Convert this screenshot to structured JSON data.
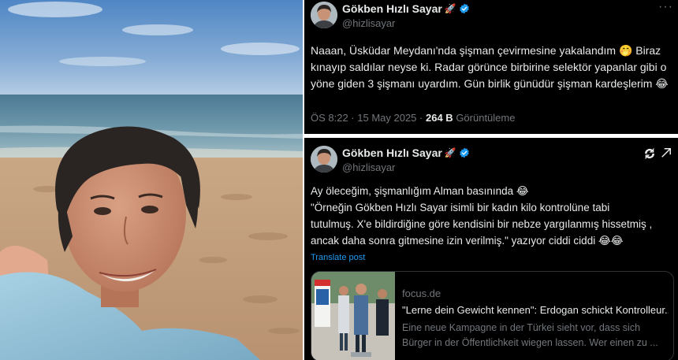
{
  "tweet1": {
    "display_name": "Gökben Hızlı Sayar",
    "handle": "@hizlisayar",
    "more_label": "···",
    "text": "Naaan, Üsküdar Meydanı'nda şişman çevirmesine yakalandım 🤭 Biraz\nkınayıp saldılar neyse ki. Radar görünce birbirine selektör yapanlar gibi o\nyöne giden 3 şişmanı uyardım. Gün birlik günüdür şişman kardeşlerim 😂",
    "time": "ÖS 8:22 · 15 May 2025 ·",
    "views_count": "264 B",
    "views_label": "Görüntüleme"
  },
  "tweet2": {
    "display_name": "Gökben Hızlı Sayar",
    "handle": "@hizlisayar",
    "text": "Ay öleceğim, şişmanlığım Alman basınında 😂\n\"Örneğin Gökben Hızlı Sayar isimli bir kadın kilo kontrolüne tabi\ntutulmuş. X'e bildirdiğine göre kendisini bir nebze yargılanmış hissetmiş ,\nancak daha sonra gitmesine izin verilmiş.\" yazıyor ciddi ciddi 😂😂",
    "translate_label": "Translate post",
    "card": {
      "domain": "focus.de",
      "title": "\"Lerne dein Gewicht kennen\": Erdogan schickt Kontrolleur...",
      "description": "Eine neue Kampagne in der Türkei sieht vor, dass sich Bürger in der Öffentlichkeit wiegen lassen. Wer einen zu ..."
    }
  },
  "colors": {
    "background": "#000000",
    "text_primary": "#e7e9ea",
    "text_secondary": "#71767b",
    "link": "#1d9bf0",
    "border": "#2f3336"
  },
  "icons": [
    "verified-badge-icon",
    "rocket-emoji-icon",
    "more-icon",
    "repost-icon",
    "grok-icon"
  ]
}
